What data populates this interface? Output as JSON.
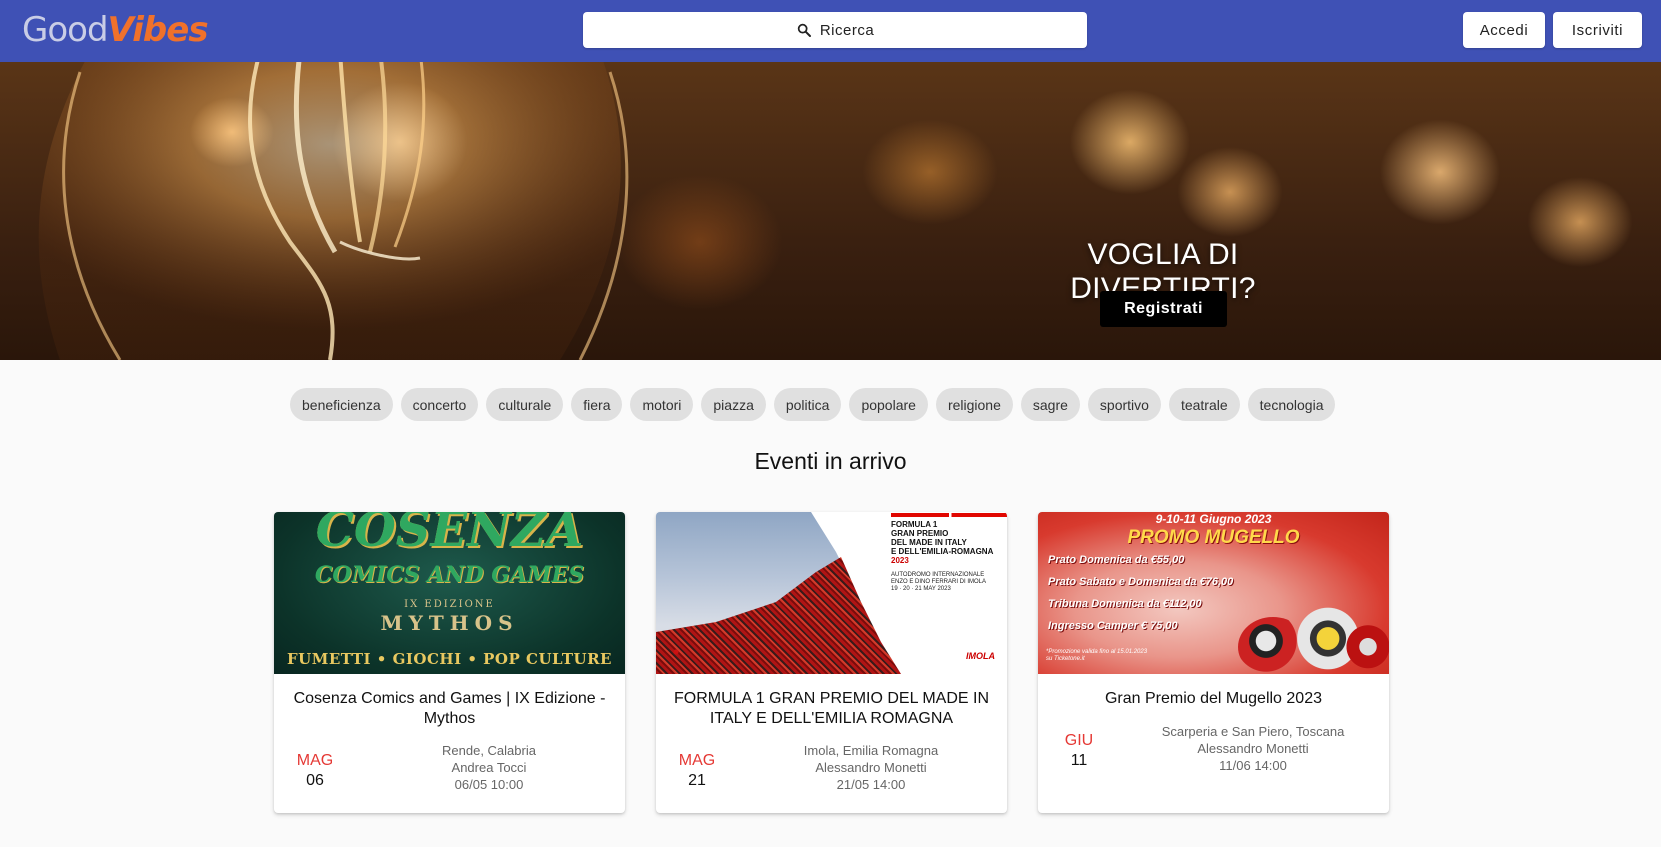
{
  "header": {
    "logo_part1": "Good",
    "logo_part2": "Vibes",
    "search_label": "Ricerca",
    "login_label": "Accedi",
    "signup_label": "Iscriviti"
  },
  "hero": {
    "title": "VOGLIA DI DIVERTIRTI?",
    "cta_label": "Registrati"
  },
  "categories": [
    "beneficienza",
    "concerto",
    "culturale",
    "fiera",
    "motori",
    "piazza",
    "politica",
    "popolare",
    "religione",
    "sagre",
    "sportivo",
    "teatrale",
    "tecnologia"
  ],
  "section_title": "Eventi in arrivo",
  "events": [
    {
      "title": "Cosenza Comics and Games | IX Edizione - Mythos",
      "month": "MAG",
      "day": "06",
      "location": "Rende, Calabria",
      "organizer": "Andrea Tocci",
      "datetime": "06/05 10:00",
      "image": {
        "title": "COSENZA",
        "subtitle": "COMICS AND GAMES",
        "edition": "IX EDIZIONE",
        "theme": "MYTHOS",
        "tagline": "FUMETTI • GIOCHI • POP CULTURE"
      }
    },
    {
      "title": "FORMULA 1 GRAN PREMIO DEL MADE IN ITALY E DELL'EMILIA ROMAGNA",
      "month": "MAG",
      "day": "21",
      "location": "Imola, Emilia Romagna",
      "organizer": "Alessandro Monetti",
      "datetime": "21/05 14:00",
      "image": {
        "headline_1": "FORMULA 1",
        "headline_2": "GRAN PREMIO",
        "headline_3": "DEL MADE IN ITALY",
        "headline_4": "E DELL'EMILIA-ROMAGNA",
        "year": "2023",
        "venue_1": "AUTODROMO INTERNAZIONALE",
        "venue_2": "ENZO E DINO FERRARI DI IMOLA",
        "dates": "19 · 20 · 21 MAY 2023",
        "brand": "IMOLA"
      }
    },
    {
      "title": "Gran Premio del Mugello 2023",
      "month": "GIU",
      "day": "11",
      "location": "Scarperia e San Piero, Toscana",
      "organizer": "Alessandro Monetti",
      "datetime": "11/06 14:00",
      "image": {
        "dates": "9-10-11 Giugno 2023",
        "promo": "PROMO MUGELLO",
        "lines": [
          "Prato Domenica da €55,00",
          "Prato Sabato e Domenica da €76,00",
          "Tribuna Domenica da €112,00",
          "Ingresso Camper € 75,00"
        ],
        "note_1": "*Promozione valida fino al 15.01.2023",
        "note_2": "su Ticketone.it"
      }
    }
  ],
  "colors": {
    "topbar": "#3f51b5",
    "logo_accent": "#f0712b",
    "month_red": "#e53935"
  }
}
